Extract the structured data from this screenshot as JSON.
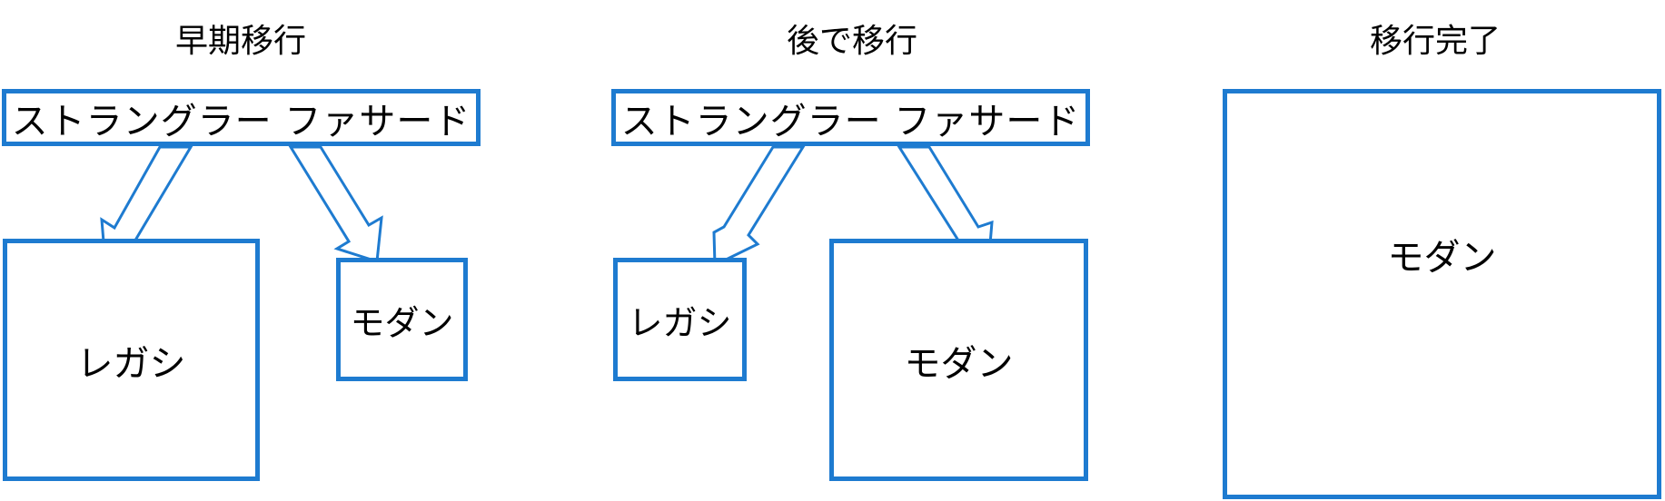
{
  "colors": {
    "accent": "#1e7bd0",
    "text": "#000000",
    "background": "#ffffff"
  },
  "stages": [
    {
      "title": "早期移行",
      "facade": "ストラングラー ファサード",
      "legacy": "レガシ",
      "modern": "モダン"
    },
    {
      "title": "後で移行",
      "facade": "ストラングラー ファサード",
      "legacy": "レガシ",
      "modern": "モダン"
    },
    {
      "title": "移行完了",
      "modern": "モダン"
    }
  ]
}
